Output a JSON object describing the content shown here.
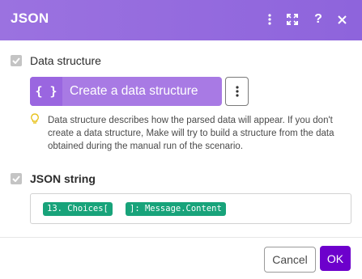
{
  "header": {
    "title": "JSON",
    "icons": [
      "more-vertical-icon",
      "expand-icon",
      "help-icon",
      "close-icon"
    ],
    "help_glyph": "?",
    "color": "#9370df"
  },
  "data_structure": {
    "label": "Data structure",
    "button_brace": "{ }",
    "button_label": "Create a data structure",
    "hint": "Data structure describes how the parsed data will appear. If you don't create a data structure, Make will try to build a structure from the data obtained during the manual run of the scenario."
  },
  "json_string": {
    "label": "JSON string",
    "tokens": [
      "13. Choices[",
      "]: Message.Content"
    ],
    "token_color": "#18a37a"
  },
  "footer": {
    "cancel_label": "Cancel",
    "ok_label": "OK",
    "ok_color": "#6d00cc"
  }
}
